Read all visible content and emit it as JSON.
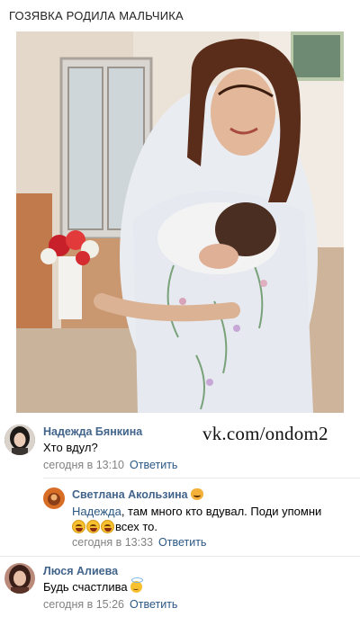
{
  "post": {
    "title": "ГОЗЯВКА РОДИЛА МАЛЬЧИКА",
    "photo_icon": "photo-mother-with-newborn",
    "watermark": "vk.com/ondom2"
  },
  "comments": [
    {
      "author": "Надежда Бянкина",
      "text": "Хто вдул?",
      "timestamp": "сегодня в 13:10",
      "reply_label": "Ответить"
    },
    {
      "author": "Светлана Акользина",
      "author_emoji": "smiling-cat-emoji",
      "mention": "Надежда",
      "text": ", там много кто вдувал. Поди упомни",
      "text_line2": "всех то.",
      "line2_emojis": [
        "rolling-laughing-emoji",
        "rolling-laughing-emoji",
        "rolling-laughing-emoji"
      ],
      "timestamp": "сегодня в 13:33",
      "reply_label": "Ответить"
    },
    {
      "author": "Люся Алиева",
      "text": "Будь счастлива",
      "text_emoji": "angel-emoji",
      "timestamp": "сегодня в 15:26",
      "reply_label": "Ответить"
    }
  ],
  "colors": {
    "author": "#42648b",
    "link": "#2a5885",
    "meta": "#828282",
    "divider": "#e7e8ec"
  }
}
